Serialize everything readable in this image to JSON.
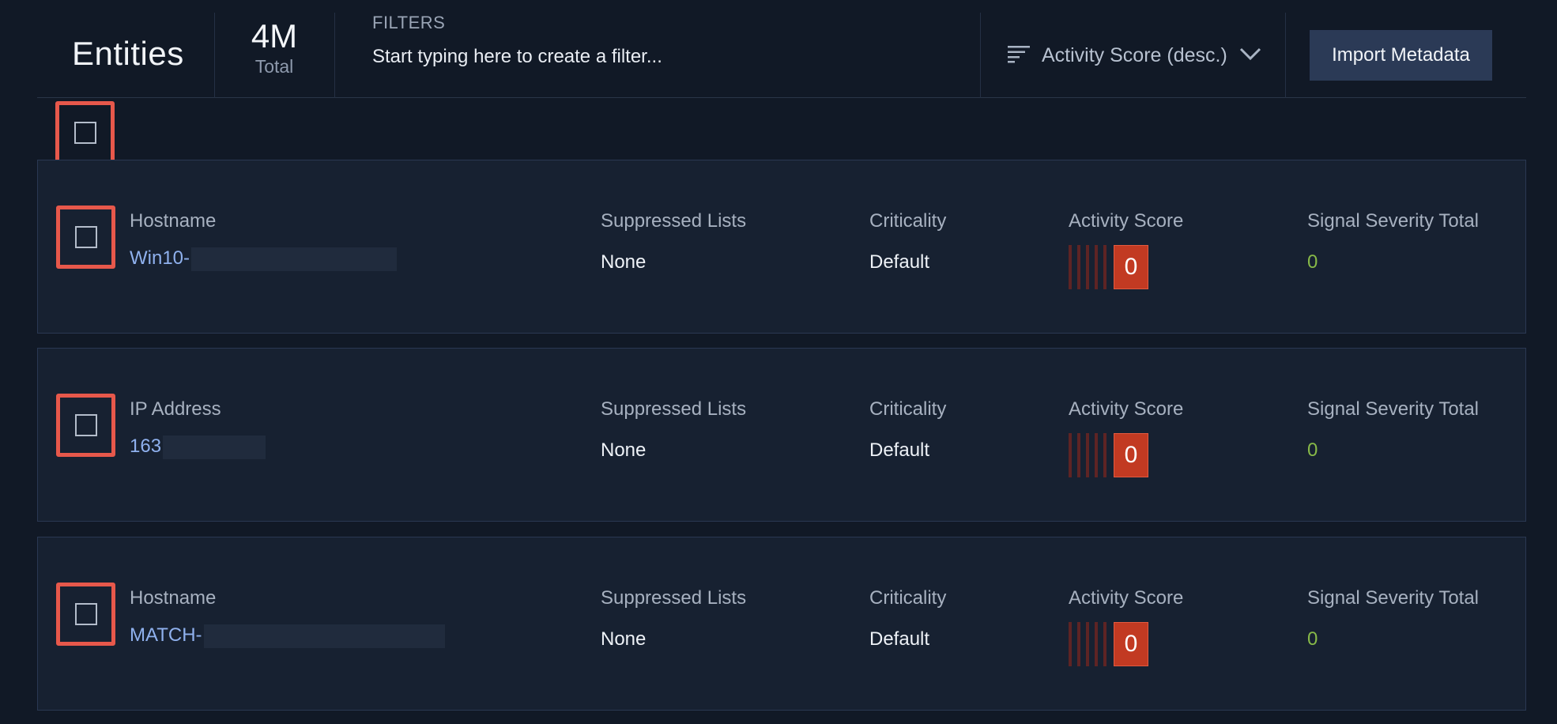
{
  "header": {
    "title": "Entities",
    "count_value": "4M",
    "count_label": "Total",
    "filters_label": "FILTERS",
    "filter_placeholder": "Start typing here to create a filter...",
    "sort_label": "Activity Score (desc.)",
    "import_label": "Import Metadata"
  },
  "columns": {
    "suppressed": "Suppressed Lists",
    "criticality": "Criticality",
    "activity": "Activity Score",
    "signal": "Signal Severity Total"
  },
  "entities": [
    {
      "type_label": "Hostname",
      "name_visible": "Win10-",
      "suppressed": "None",
      "criticality": "Default",
      "activity_score": "0",
      "signal_total": "0"
    },
    {
      "type_label": "IP Address",
      "name_visible": "163",
      "suppressed": "None",
      "criticality": "Default",
      "activity_score": "0",
      "signal_total": "0"
    },
    {
      "type_label": "Hostname",
      "name_visible": "MATCH-",
      "suppressed": "None",
      "criticality": "Default",
      "activity_score": "0",
      "signal_total": "0"
    }
  ],
  "icons": {
    "sort": "sort-lines-icon",
    "chevron": "chevron-down-icon",
    "checkbox": "checkbox-empty"
  },
  "colors": {
    "background": "#111926",
    "card": "#172131",
    "highlight": "#e7584b",
    "link": "#8fb1ee",
    "score": "#c23a22",
    "signal": "#87b948",
    "button": "#2b3a56"
  }
}
